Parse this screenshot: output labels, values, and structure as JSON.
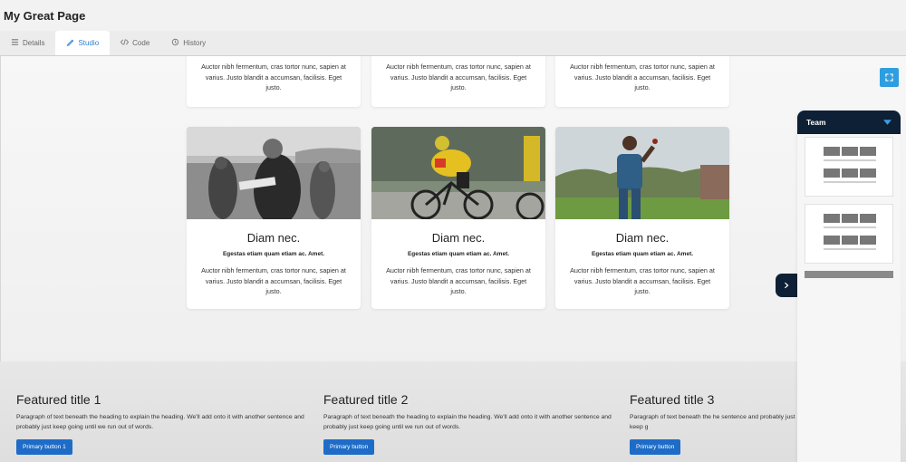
{
  "page": {
    "title": "My Great Page"
  },
  "tabs": [
    {
      "label": "Details",
      "icon": "list-icon"
    },
    {
      "label": "Studio",
      "icon": "pen-icon"
    },
    {
      "label": "Code",
      "icon": "code-icon"
    },
    {
      "label": "History",
      "icon": "history-icon"
    }
  ],
  "active_tab": "Studio",
  "top_cards": [
    {
      "text": "Auctor nibh fermentum, cras tortor nunc, sapien at varius. Justo blandit a accumsan, facilisis. Eget justo."
    },
    {
      "text": "Auctor nibh fermentum, cras tortor nunc, sapien at varius. Justo blandit a accumsan, facilisis. Eget justo."
    },
    {
      "text": "Auctor nibh fermentum, cras tortor nunc, sapien at varius. Justo blandit a accumsan, facilisis. Eget justo."
    }
  ],
  "cards": [
    {
      "title": "Diam nec.",
      "subtitle": "Egestas etiam quam etiam ac. Amet.",
      "text": "Auctor nibh fermentum, cras tortor nunc, sapien at varius. Justo blandit a accumsan, facilisis. Eget justo.",
      "image": "surfer-photo"
    },
    {
      "title": "Diam nec.",
      "subtitle": "Egestas etiam quam etiam ac. Amet.",
      "text": "Auctor nibh fermentum, cras tortor nunc, sapien at varius. Justo blandit a accumsan, facilisis. Eget justo.",
      "image": "cyclist-photo"
    },
    {
      "title": "Diam nec.",
      "subtitle": "Egestas etiam quam etiam ac. Amet.",
      "text": "Auctor nibh fermentum, cras tortor nunc, sapien at varius. Justo blandit a accumsan, facilisis. Eget justo.",
      "image": "cricket-player-photo"
    }
  ],
  "features": [
    {
      "title": "Featured title 1",
      "text": "Paragraph of text beneath the heading to explain the heading. We'll add onto it with another sentence and probably just keep going until we run out of words.",
      "button": "Primary button 1"
    },
    {
      "title": "Featured title 2",
      "text": "Paragraph of text beneath the heading to explain the heading. We'll add onto it with another sentence and probably just keep going until we run out of words.",
      "button": "Primary button"
    },
    {
      "title": "Featured title 3",
      "text": "Paragraph of text beneath the he sentence and probably just keep g",
      "button": "Primary button"
    }
  ],
  "team_panel": {
    "title": "Team",
    "thumbnails": 2
  },
  "colors": {
    "accent": "#1e6cc8",
    "tab_active": "#2f7fd0",
    "panel_dark": "#0e2035",
    "fullscreen": "#2e9ee0"
  }
}
